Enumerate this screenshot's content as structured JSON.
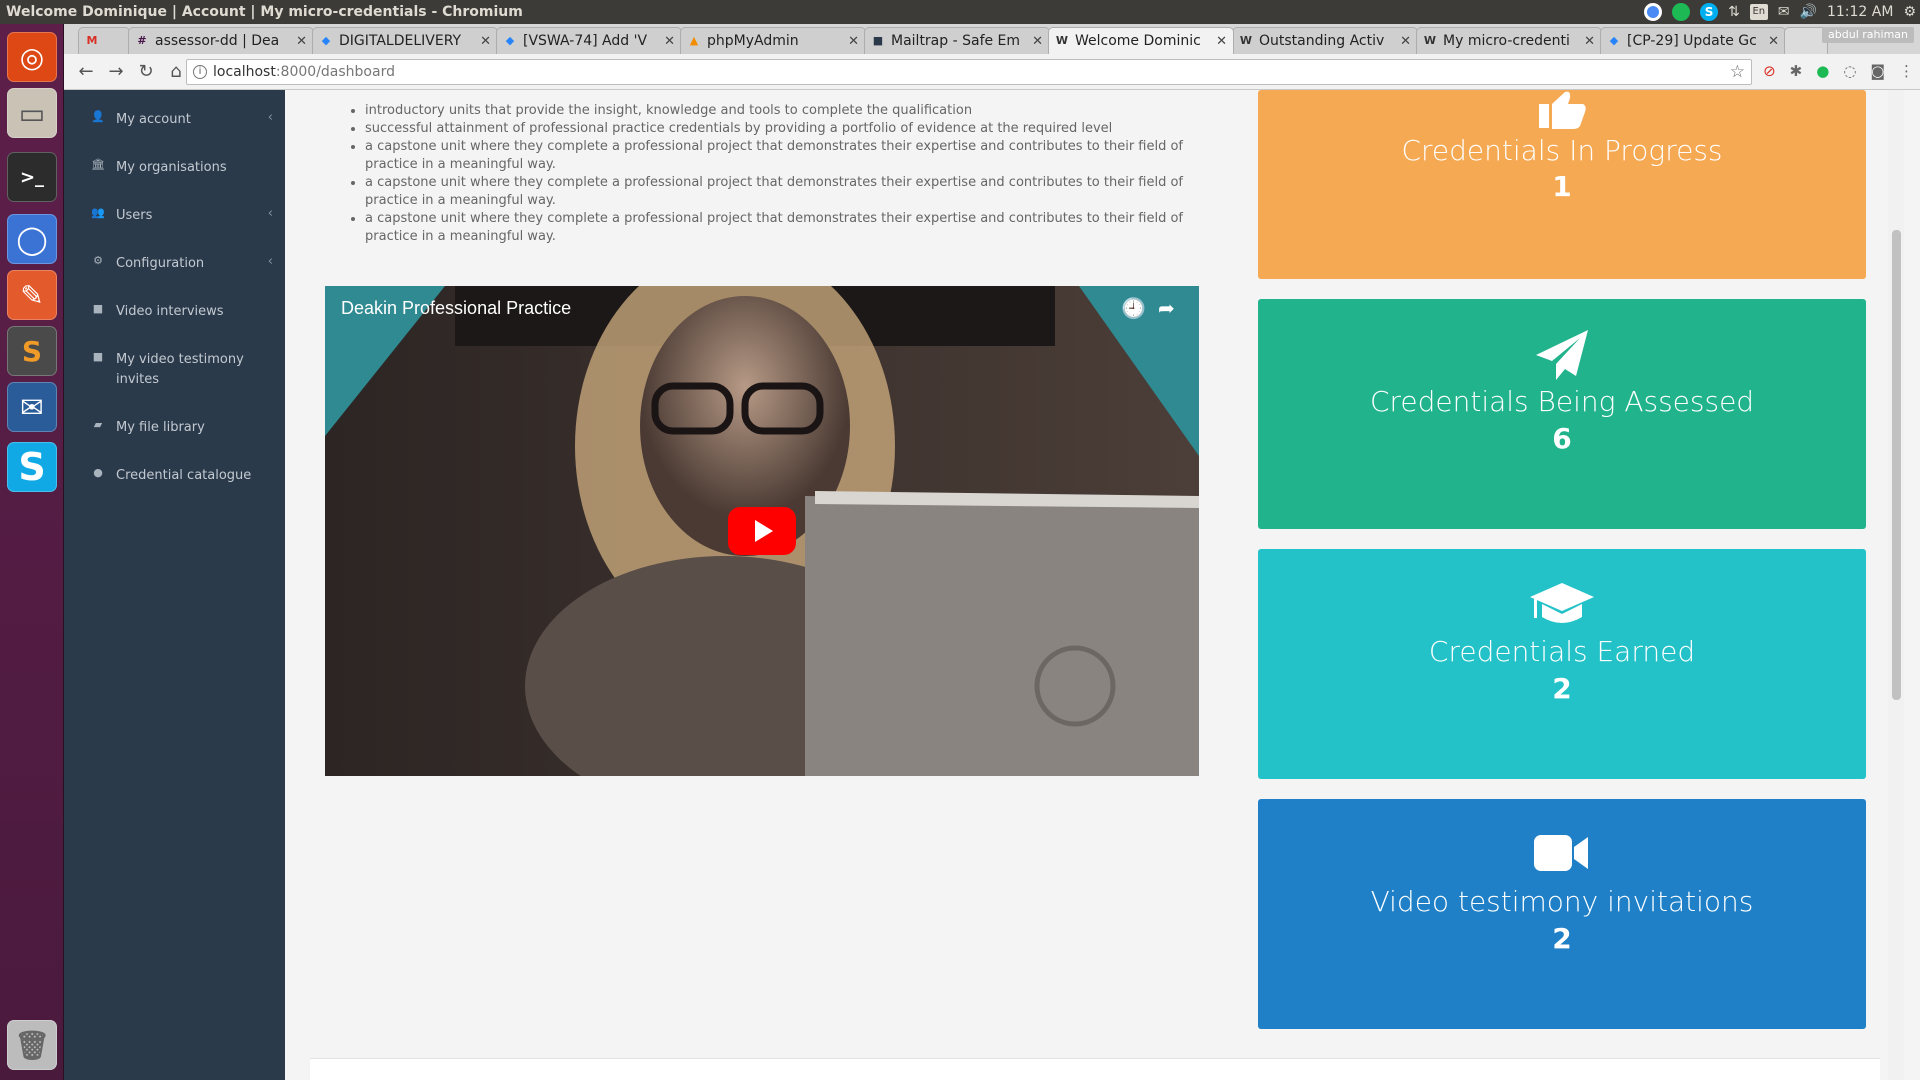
{
  "window": {
    "title": "Welcome Dominique | Account | My micro-credentials - Chromium"
  },
  "system_tray": {
    "language": "En",
    "time": "11:12 AM"
  },
  "launcher": {
    "apps": [
      "ubuntu-dash-icon",
      "files-icon",
      "terminal-icon",
      "chromium-icon",
      "text-editor-icon",
      "sublime-text-icon",
      "thunderbird-icon",
      "skype-icon",
      "trash-icon"
    ]
  },
  "tabs": [
    {
      "label": "",
      "favicon": "M",
      "color": "#d93025"
    },
    {
      "label": "assessor-dd | Dea",
      "favicon": "#",
      "color": "#4a154b"
    },
    {
      "label": "DIGITALDELIVERY",
      "favicon": "◆",
      "color": "#2684ff"
    },
    {
      "label": "[VSWA-74] Add 'V",
      "favicon": "◆",
      "color": "#2684ff"
    },
    {
      "label": "phpMyAdmin",
      "favicon": "▲",
      "color": "#f28c00"
    },
    {
      "label": "Mailtrap - Safe Em",
      "favicon": "■",
      "color": "#2b3a4a"
    },
    {
      "label": "Welcome Dominic",
      "favicon": "W",
      "color": "#333333"
    },
    {
      "label": "Outstanding Activ",
      "favicon": "W",
      "color": "#333333"
    },
    {
      "label": "My micro-credenti",
      "favicon": "W",
      "color": "#333333"
    },
    {
      "label": "[CP-29] Update Gc",
      "favicon": "◆",
      "color": "#2684ff"
    }
  ],
  "profile_name": "abdul rahiman",
  "address_bar": {
    "host": "localhost",
    "path": ":8000/dashboard"
  },
  "sidebar": {
    "items": [
      {
        "label": "My account",
        "icon": "user-icon",
        "glyph": "👤",
        "has_chevron": true
      },
      {
        "label": "My organisations",
        "icon": "bank-icon",
        "glyph": "🏛",
        "has_chevron": false
      },
      {
        "label": "Users",
        "icon": "users-icon",
        "glyph": "👥",
        "has_chevron": true
      },
      {
        "label": "Configuration",
        "icon": "gears-icon",
        "glyph": "⚙",
        "has_chevron": true
      },
      {
        "label": "Video interviews",
        "icon": "video-camera-icon",
        "glyph": "■",
        "has_chevron": false
      },
      {
        "label": "My video testimony invites",
        "icon": "video-camera-icon",
        "glyph": "■",
        "has_chevron": false
      },
      {
        "label": "My file library",
        "icon": "folder-open-icon",
        "glyph": "▰",
        "has_chevron": false
      },
      {
        "label": "Credential catalogue",
        "icon": "circle-icon",
        "glyph": "●",
        "has_chevron": false
      }
    ]
  },
  "main": {
    "bullets": [
      "introductory units that provide the insight, knowledge and tools to complete the qualification",
      "successful attainment of professional practice credentials by providing a portfolio of evidence at the required level",
      "a capstone unit where they complete a professional project that demonstrates their expertise and contributes to their field of practice in a meaningful way.",
      "a capstone unit where they complete a professional project that demonstrates their expertise and contributes to their field of practice in a meaningful way.",
      "a capstone unit where they complete a professional project that demonstrates their expertise and contributes to their field of practice in a meaningful way."
    ],
    "video": {
      "title": "Deakin Professional Practice"
    }
  },
  "cards": [
    {
      "title": "Credentials In Progress",
      "count": "1",
      "icon": "thumbs-up-icon",
      "color": "#f6a953"
    },
    {
      "title": "Credentials Being Assessed",
      "count": "6",
      "icon": "paper-plane-icon",
      "color": "#21b38c"
    },
    {
      "title": "Credentials Earned",
      "count": "2",
      "icon": "graduation-cap-icon",
      "color": "#23c2c8"
    },
    {
      "title": "Video testimony invitations",
      "count": "2",
      "icon": "video-camera-icon",
      "color": "#1f80c7"
    }
  ]
}
